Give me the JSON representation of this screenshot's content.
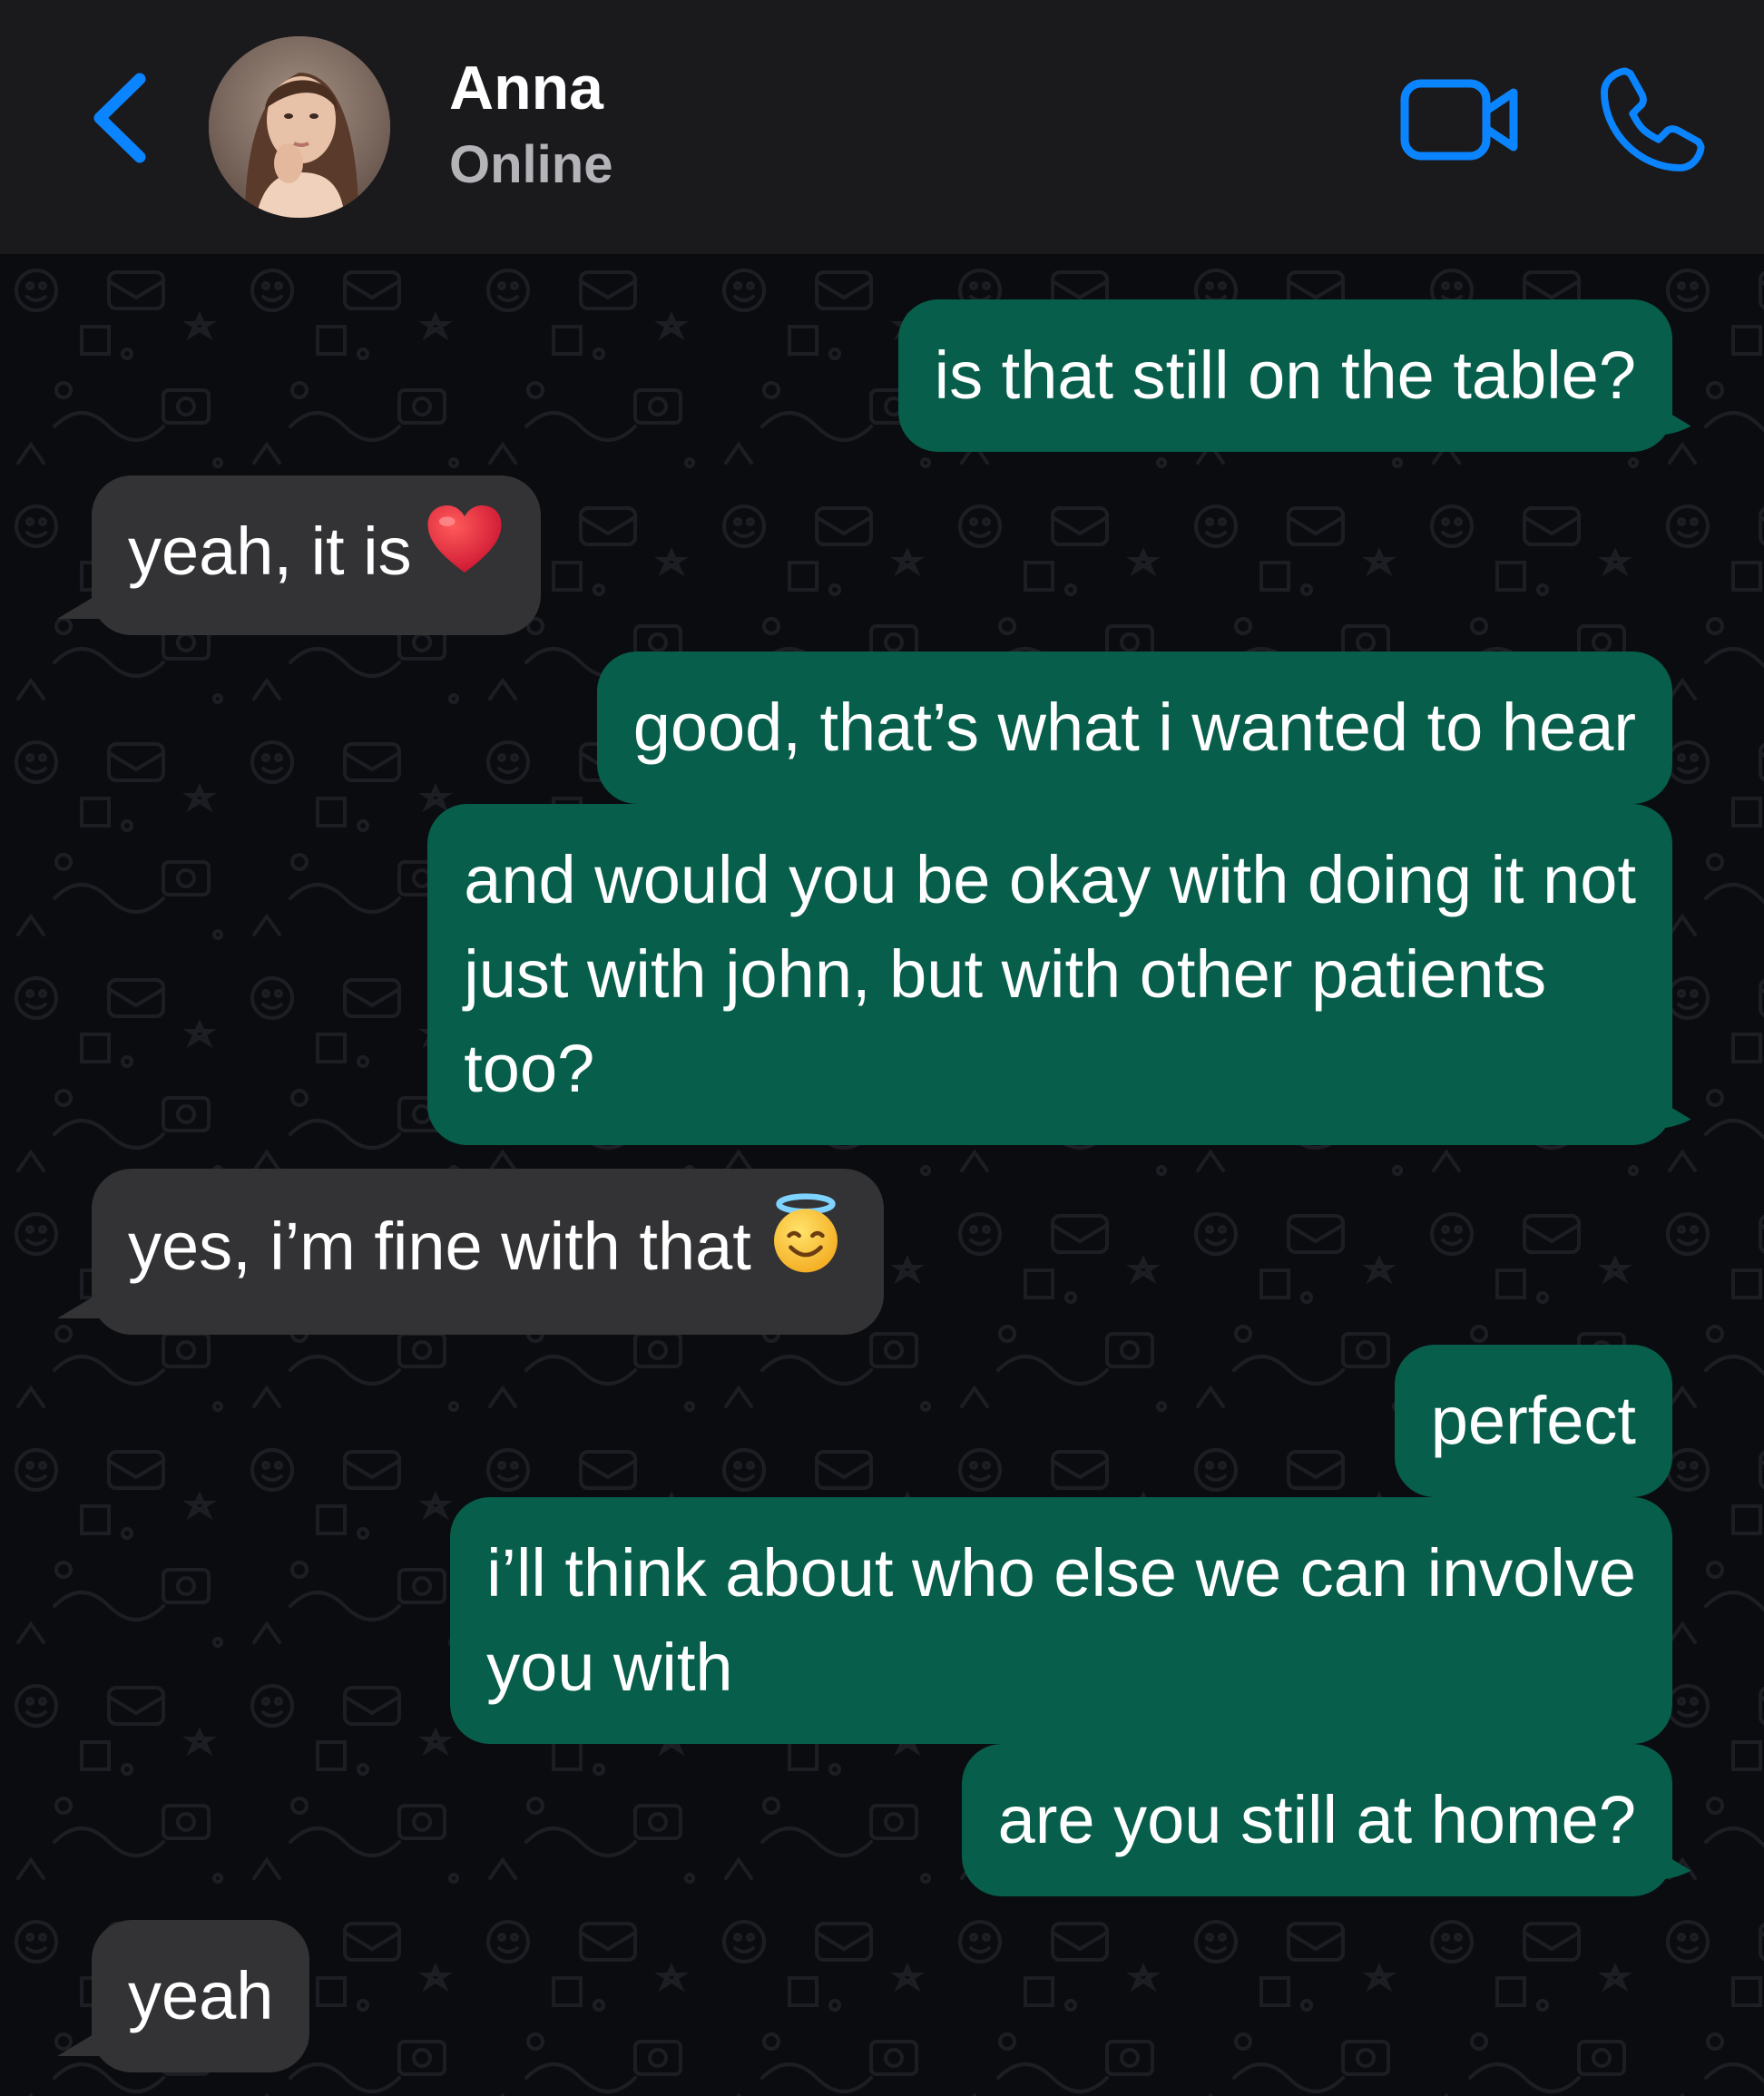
{
  "header": {
    "contact_name": "Anna",
    "contact_status": "Online",
    "back_icon": "chevron-left-icon",
    "video_icon": "video-camera-icon",
    "call_icon": "phone-icon",
    "accent_color": "#0a84ff"
  },
  "colors": {
    "outgoing_bubble": "#075e4b",
    "incoming_bubble": "#333335",
    "header_bg": "#1a1a1c",
    "chat_bg": "#0b0c10"
  },
  "messages": [
    {
      "direction": "outgoing",
      "text": "is that still on the table?"
    },
    {
      "direction": "incoming",
      "text": "yeah, it is",
      "emoji": "red-heart"
    },
    {
      "direction": "outgoing",
      "text": "good, that’s what i wanted to hear"
    },
    {
      "direction": "outgoing",
      "lines": [
        "and would you be okay with doing it not",
        "just with john, but with other patients",
        "too?"
      ]
    },
    {
      "direction": "incoming",
      "text": "yes, i’m fine with that",
      "emoji": "smiling-face-with-halo"
    },
    {
      "direction": "outgoing",
      "text": "perfect"
    },
    {
      "direction": "outgoing",
      "lines": [
        "i’ll think about who else we can involve",
        "you with"
      ]
    },
    {
      "direction": "outgoing",
      "text": "are you still at home?"
    },
    {
      "direction": "incoming",
      "text": "yeah"
    }
  ]
}
